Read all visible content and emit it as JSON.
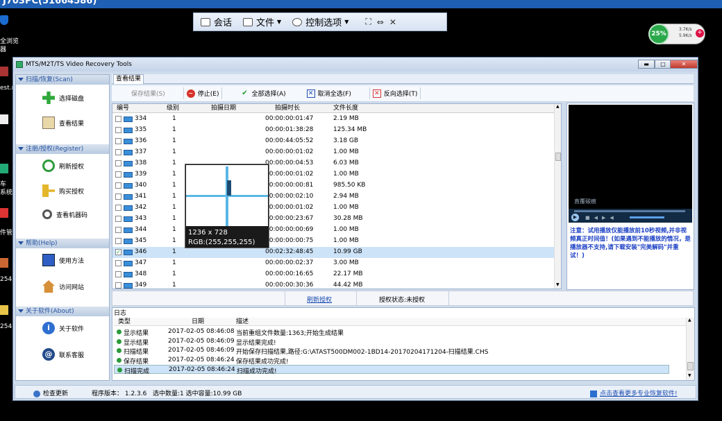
{
  "remote": {
    "title": "J703PC(51664586)",
    "toolbar": {
      "chat": "会话",
      "file": "文件",
      "control": "控制选项"
    }
  },
  "desktop_icons": [
    {
      "label": "全浏览"
    },
    {
      "label": "器"
    },
    {
      "label": "est.r"
    },
    {
      "label": "车"
    },
    {
      "label": "系统"
    },
    {
      "label": "件管"
    },
    {
      "label": "254"
    },
    {
      "label": "254"
    }
  ],
  "widget": {
    "percent": "25%",
    "up": "3.7K/s",
    "down": "5.9K/s",
    "plus": "+"
  },
  "window": {
    "title": "MTS/M2T/TS Video Recovery Tools",
    "controls": {
      "minimize": "▬",
      "maximize": "□",
      "close": "✕"
    }
  },
  "sidebar": {
    "sections": [
      {
        "title": "扫描/恢复(Scan)",
        "items": [
          "选择磁盘",
          "查看结果"
        ]
      },
      {
        "title": "注册/授权(Register)",
        "items": [
          "刷新授权",
          "购买授权",
          "查看机器码"
        ]
      },
      {
        "title": "帮助(Help)",
        "items": [
          "使用方法",
          "访问网站"
        ]
      },
      {
        "title": "关于软件(About)",
        "items": [
          "关于软件",
          "联系客服"
        ]
      }
    ]
  },
  "tab": {
    "label": "查看结果"
  },
  "toolbar": {
    "save": "保存结果(S)",
    "stop": "停止(E)",
    "select_all": "全部选择(A)",
    "deselect_all": "取消全选(F)",
    "invert": "反向选择(T)"
  },
  "list": {
    "headers": [
      "编号",
      "级别",
      "拍摄日期",
      "拍摄时长",
      "文件长度"
    ],
    "rows": [
      {
        "id": "334",
        "level": "1",
        "date": "",
        "duration": "00:00:00:01:47",
        "size": "2.19 MB",
        "checked": false
      },
      {
        "id": "335",
        "level": "1",
        "date": "",
        "duration": "00:00:01:38:28",
        "size": "125.34 MB",
        "checked": false
      },
      {
        "id": "336",
        "level": "1",
        "date": "",
        "duration": "00:00:44:05:52",
        "size": "3.18 GB",
        "checked": false
      },
      {
        "id": "337",
        "level": "1",
        "date": "",
        "duration": "00:00:00:01:02",
        "size": "1.00 MB",
        "checked": false
      },
      {
        "id": "338",
        "level": "1",
        "date": "",
        "duration": "00:00:00:04:53",
        "size": "6.03 MB",
        "checked": false
      },
      {
        "id": "339",
        "level": "1",
        "date": "",
        "duration": "00:00:00:01:02",
        "size": "1.00 MB",
        "checked": false
      },
      {
        "id": "340",
        "level": "1",
        "date": "",
        "duration": "00:00:00:00:81",
        "size": "985.50 KB",
        "checked": false
      },
      {
        "id": "341",
        "level": "1",
        "date": "",
        "duration": "00:00:00:02:10",
        "size": "2.94 MB",
        "checked": false
      },
      {
        "id": "342",
        "level": "1",
        "date": "",
        "duration": "00:00:00:01:02",
        "size": "1.00 MB",
        "checked": false
      },
      {
        "id": "343",
        "level": "1",
        "date": "",
        "duration": "00:00:00:23:67",
        "size": "30.28 MB",
        "checked": false
      },
      {
        "id": "344",
        "level": "1",
        "date": "",
        "duration": "00:00:00:00:69",
        "size": "1.00 MB",
        "checked": false
      },
      {
        "id": "345",
        "level": "1",
        "date": "",
        "duration": "00:00:00:00:75",
        "size": "1.00 MB",
        "checked": false
      },
      {
        "id": "346",
        "level": "1",
        "date": "",
        "duration": "00:02:32:48:45",
        "size": "10.99 GB",
        "checked": true
      },
      {
        "id": "347",
        "level": "1",
        "date": "",
        "duration": "00:00:00:02:37",
        "size": "3.00 MB",
        "checked": false
      },
      {
        "id": "348",
        "level": "1",
        "date": "",
        "duration": "00:00:00:16:65",
        "size": "22.17 MB",
        "checked": false
      },
      {
        "id": "349",
        "level": "1",
        "date": "",
        "duration": "00:00:00:30:36",
        "size": "44.42 MB",
        "checked": false
      }
    ]
  },
  "preview": {
    "name": "直覆碳痕",
    "note": "注意：试用播放仅能播放前10秒视频,并非视频真正时间值！(如果遇到不能播放的情况，是播放器不支持,请下载安装\"完美解码\"并重试！)"
  },
  "midbar": {
    "refresh": "刷新授权",
    "auth_status": "授权状态:未授权"
  },
  "log": {
    "title": "日志",
    "headers": [
      "类型",
      "日期",
      "描述"
    ],
    "rows": [
      {
        "type": "显示结果",
        "date": "2017-02-05 08:46:08",
        "desc": "当前重组文件数量:1363;开始生成结果"
      },
      {
        "type": "显示结果",
        "date": "2017-02-05 08:46:09",
        "desc": "显示结果完成!"
      },
      {
        "type": "扫描结果",
        "date": "2017-02-05 08:46:09",
        "desc": "开始保存扫描结果,路径:G:\\ATAST500DM002-1BD14-20170204171204-扫描结果.CHS"
      },
      {
        "type": "保存结果",
        "date": "2017-02-05 08:46:24",
        "desc": "保存结果成功完成!"
      },
      {
        "type": "扫描完成",
        "date": "2017-02-05 08:46:24",
        "desc": "扫描成功完成!"
      }
    ]
  },
  "statusbar": {
    "check_update": "检查更新",
    "version": "程序版本： 1.2.3.6",
    "selection": "选中数量:1 选中容量:10.99 GB",
    "more": "点击查看更多专业恢复软件!"
  },
  "tooltip": {
    "size": "1236 x 728",
    "rgb": "RGB:(255,255,255)"
  }
}
